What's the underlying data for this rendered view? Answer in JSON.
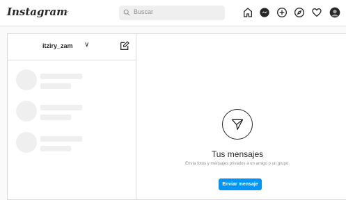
{
  "header": {
    "logo": "Instagram",
    "search_placeholder": "Buscar",
    "nav_icons": [
      "home-icon",
      "messenger-icon",
      "new-post-icon",
      "explore-icon",
      "heart-icon",
      "avatar"
    ]
  },
  "sidebar": {
    "username": "itziry_zam"
  },
  "main": {
    "title": "Tus mensajes",
    "subtitle": "Envía fotos y mensajes privados a un amigo o un grupo.",
    "button_label": "Enviar mensaje"
  },
  "colors": {
    "accent": "#0095f6",
    "border": "#dbdbdb",
    "skeleton": "#efefef",
    "background": "#fafafa"
  }
}
